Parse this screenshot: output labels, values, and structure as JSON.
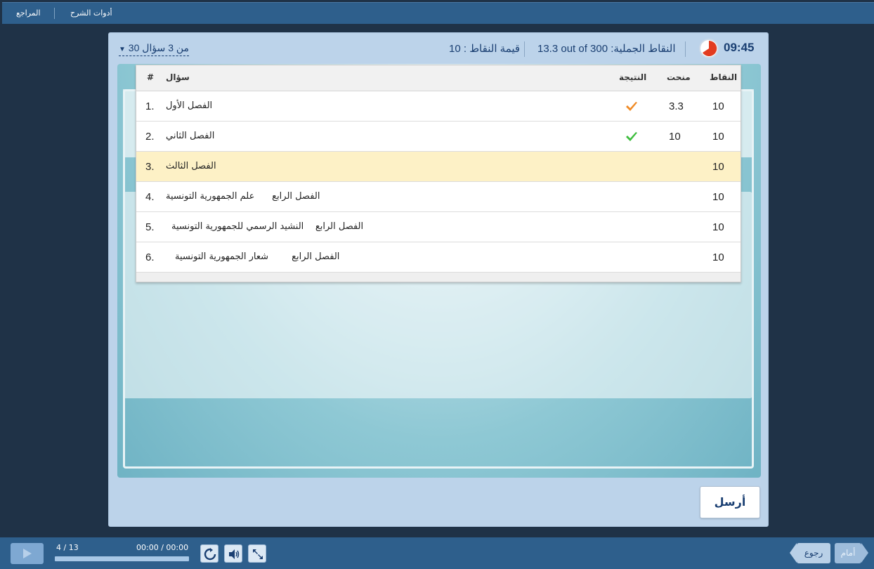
{
  "topbar": {
    "references_label": "المراجع",
    "tools_label": "أدوات الشرح"
  },
  "quiz": {
    "timer": "09:45",
    "score_text": "13.3 out of 300 :النقاط الجملية",
    "points_value_text": "10 : قيمة النقاط",
    "question_nav": "30 من 3 سؤال",
    "columns": {
      "points": "النقاط",
      "awarded": "منحت",
      "result": "النتيجة",
      "question": "سؤال",
      "number": "#"
    },
    "rows": [
      {
        "number": "1.",
        "question": "الفصل الأول",
        "points": "10",
        "awarded": "3.3",
        "result": "partial"
      },
      {
        "number": "2.",
        "question": "الفصل الثاني",
        "points": "10",
        "awarded": "10",
        "result": "correct"
      },
      {
        "number": "3.",
        "question": "الفصل الثالث",
        "points": "10",
        "awarded": "",
        "result": "none"
      },
      {
        "number": "4.",
        "question": "الفصل الرابع      علم الجمهورية التونسية",
        "points": "10",
        "awarded": "",
        "result": "none"
      },
      {
        "number": "5.",
        "question": "الفصل الرابع    النشيد الرسمي للجمهورية التونسية",
        "points": "10",
        "awarded": "",
        "result": "none"
      },
      {
        "number": "6.",
        "question": "الفصل الرابع        شعار الجمهورية التونسية",
        "points": "10",
        "awarded": "",
        "result": "none"
      }
    ],
    "submit_label": "أرسل"
  },
  "player": {
    "slide_count": "4 / 13",
    "time": "00:00 / 00:00",
    "back_label": "رجوع",
    "forward_label": "أمام"
  },
  "colors": {
    "partial_check": "#f08a24",
    "correct_check": "#3ebd3e",
    "accent": "#1a3f72",
    "current_row": "#fdf1c6"
  }
}
